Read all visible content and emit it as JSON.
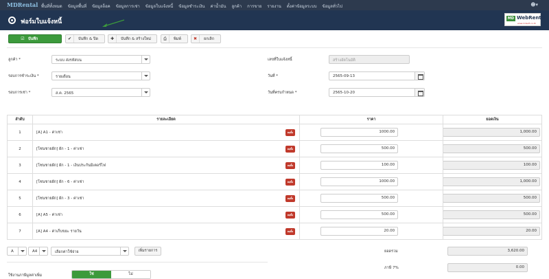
{
  "nav": {
    "brand": "MDRental",
    "menu": [
      "พื้นที่ทั้งหมด",
      "ข้อมูลพื้นที่",
      "ข้อมูลล็อค",
      "ข้อมูลการเช่า",
      "ข้อมูลใบแจ้งหนี้",
      "ข้อมูลชำระเงิน",
      "ค่าน้ำมัน",
      "ลูกค้า",
      "การขาย",
      "รายงาน",
      "ตั้งค่าข้อมูลระบบ",
      "ข้อมูลทั่วไป"
    ],
    "user_icon": "user-icon"
  },
  "header": {
    "title": "ฟอร์มใบแจ้งหนี้",
    "logo_md": "MD",
    "logo_name": "WebRental",
    "logo_sub": "www.mdsoft.co.th"
  },
  "toolbar": {
    "save": "บันทึก",
    "save_close": "บันทึก & ปิด",
    "save_new": "บันทึก & สร้างใหม่",
    "print": "พิมพ์",
    "cancel": "ยกเลิก"
  },
  "form": {
    "customer_label": "ลูกค้า *",
    "customer_value": "ระบบ ส่งรหัสบน",
    "payment_cycle_label": "รอบการชำระเงิน *",
    "payment_cycle_value": "รายเดือน",
    "rental_cycle_label": "รอบการเช่า *",
    "rental_cycle_value": "ส.ค. 2565",
    "invoice_no_label": "เลขที่ใบแจ้งหนี้",
    "invoice_no_placeholder": "สร้างอัตโนมัติ",
    "date_label": "วันที่ *",
    "date_value": "2565-09-13",
    "due_date_label": "วันที่ครบกำหนด *",
    "due_date_value": "2565-10-20"
  },
  "table": {
    "headers": [
      "ลำดับ",
      "รายละเอียด",
      "ราคา",
      "ยอดเงิน"
    ],
    "delete_label": "ลบทิ้ง",
    "rows": [
      {
        "no": "1",
        "desc": "[A] A1 - ค่าเช่า",
        "price": "1000.00",
        "amount": "1,000.00"
      },
      {
        "no": "2",
        "desc": "[โซนชายผัก] ผัก - 1 - ค่าเช่า",
        "price": "500.00",
        "amount": "500.00"
      },
      {
        "no": "3",
        "desc": "[โซนชายผัก] ผัก - 1 - เงินประกันมิเตอร์ไฟ",
        "price": "100.00",
        "amount": "100.00"
      },
      {
        "no": "4",
        "desc": "[โซนชายผัก] ผัก - 6 - ค่าเช่า",
        "price": "1000.00",
        "amount": "1,000.00"
      },
      {
        "no": "5",
        "desc": "[โซนชายผัก] ผัก - 3 - ค่าเช่า",
        "price": "500.00",
        "amount": "500.00"
      },
      {
        "no": "6",
        "desc": "[A] A5 - ค่าเช่า",
        "price": "500.00",
        "amount": "500.00"
      },
      {
        "no": "7",
        "desc": "[A] A4 - ค่าเก็บขยะ รายวัน",
        "price": "20.00",
        "amount": "20.00"
      }
    ]
  },
  "add_line": {
    "zone": "A",
    "lock": "A4",
    "expense_placeholder": "เลือกค่าใช้จ่าย",
    "add_button": "เพิ่มรายการ"
  },
  "summary": {
    "total_label": "ยอดรวม",
    "total_value": "3,620.00",
    "vat_label": "ภาษี 7%",
    "vat_value": "0.00",
    "use_vat_label": "ใช้งานภาษีมูลค่าเพิ่ม",
    "yes": "ใช่",
    "no": "ไม่"
  },
  "colors": {
    "nav": "#2d3a4e",
    "header": "#213552",
    "save": "#3c9a3c",
    "delete": "#c0392b"
  }
}
